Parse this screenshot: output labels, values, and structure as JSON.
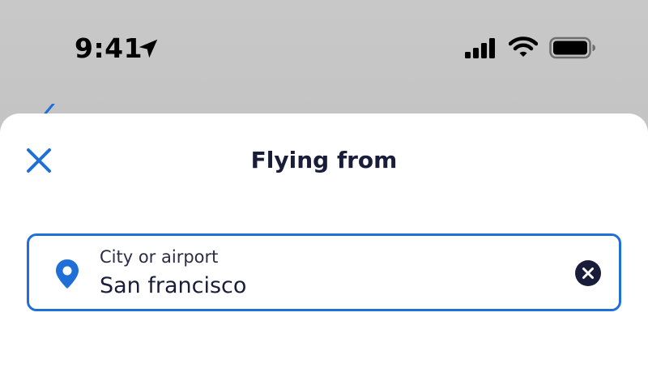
{
  "status_bar": {
    "time": "9:41",
    "icons": [
      "location-arrow-icon",
      "cellular-signal-icon",
      "wifi-icon",
      "battery-icon"
    ]
  },
  "sheet": {
    "title": "Flying from",
    "close_icon": "close-icon"
  },
  "search": {
    "label": "City or airport",
    "value": "San francisco",
    "leading_icon": "location-pin-icon",
    "trailing_icon": "clear-icon"
  },
  "colors": {
    "accent": "#1f6fd6",
    "title_text": "#1a1d3a",
    "clear_button_bg": "#1a1d3a",
    "backdrop": "#c4c4c4"
  }
}
